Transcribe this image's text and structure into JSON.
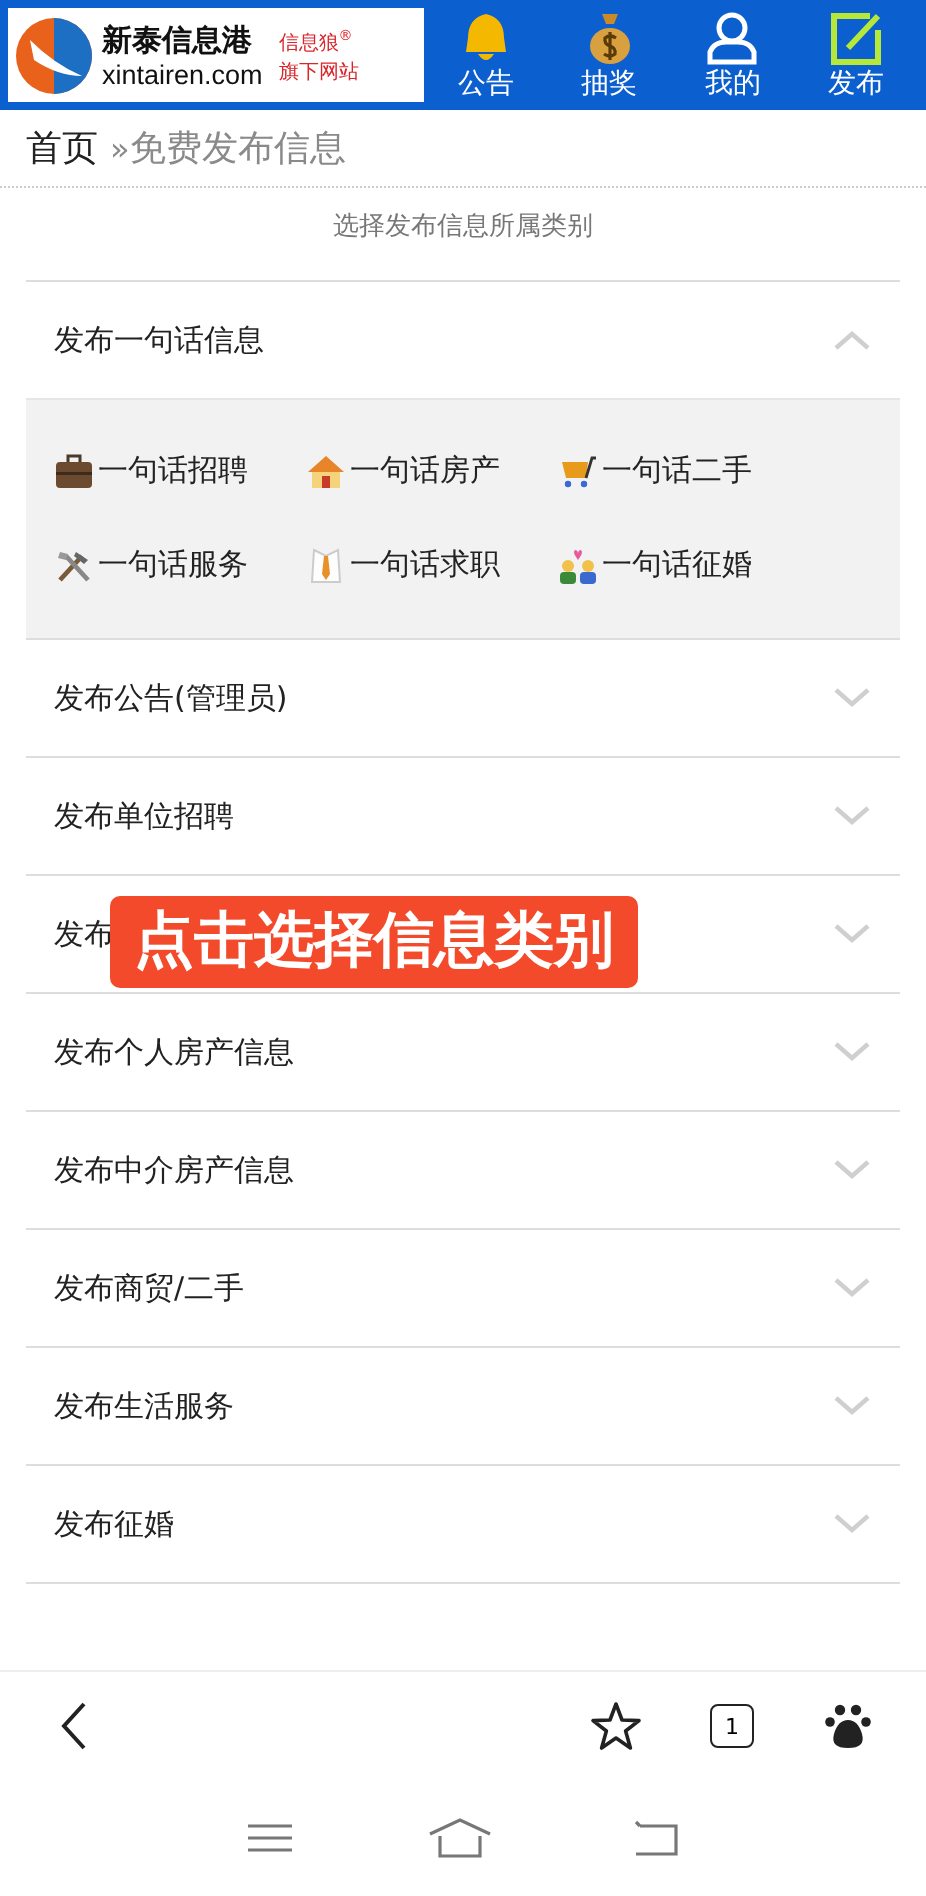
{
  "header": {
    "site_name": "新泰信息港",
    "domain": "xintairen.com",
    "tagline": [
      "信息狼$^{®}$",
      "旗下网站"
    ],
    "nav": [
      {
        "label": "公告",
        "kind": "bell"
      },
      {
        "label": "抽奖",
        "kind": "moneybag"
      },
      {
        "label": "我的",
        "kind": "user"
      },
      {
        "label": "发布",
        "kind": "edit"
      }
    ]
  },
  "breadcrumb": {
    "home": "首页",
    "separator": "»",
    "current": "免费发布信息"
  },
  "subtitle": "选择发布信息所属类别",
  "sections": [
    {
      "title": "发布一句话信息",
      "expanded": true,
      "items": [
        {
          "label": "一句话招聘",
          "kind": "briefcase"
        },
        {
          "label": "一句话房产",
          "kind": "house"
        },
        {
          "label": "一句话二手",
          "kind": "cart"
        },
        {
          "label": "一句话服务",
          "kind": "tools"
        },
        {
          "label": "一句话求职",
          "kind": "tie"
        },
        {
          "label": "一句话征婚",
          "kind": "couple"
        }
      ]
    },
    {
      "title": "发布公告(管理员)",
      "expanded": false
    },
    {
      "title": "发布单位招聘",
      "expanded": false
    },
    {
      "title": "发布",
      "expanded": false
    },
    {
      "title": "发布个人房产信息",
      "expanded": false
    },
    {
      "title": "发布中介房产信息",
      "expanded": false
    },
    {
      "title": "发布商贸/二手",
      "expanded": false
    },
    {
      "title": "发布生活服务",
      "expanded": false
    },
    {
      "title": "发布征婚",
      "expanded": false
    }
  ],
  "overlay_banner": {
    "text": "点击选择信息类别"
  },
  "browser_toolbar": {
    "tab_count": "1"
  }
}
